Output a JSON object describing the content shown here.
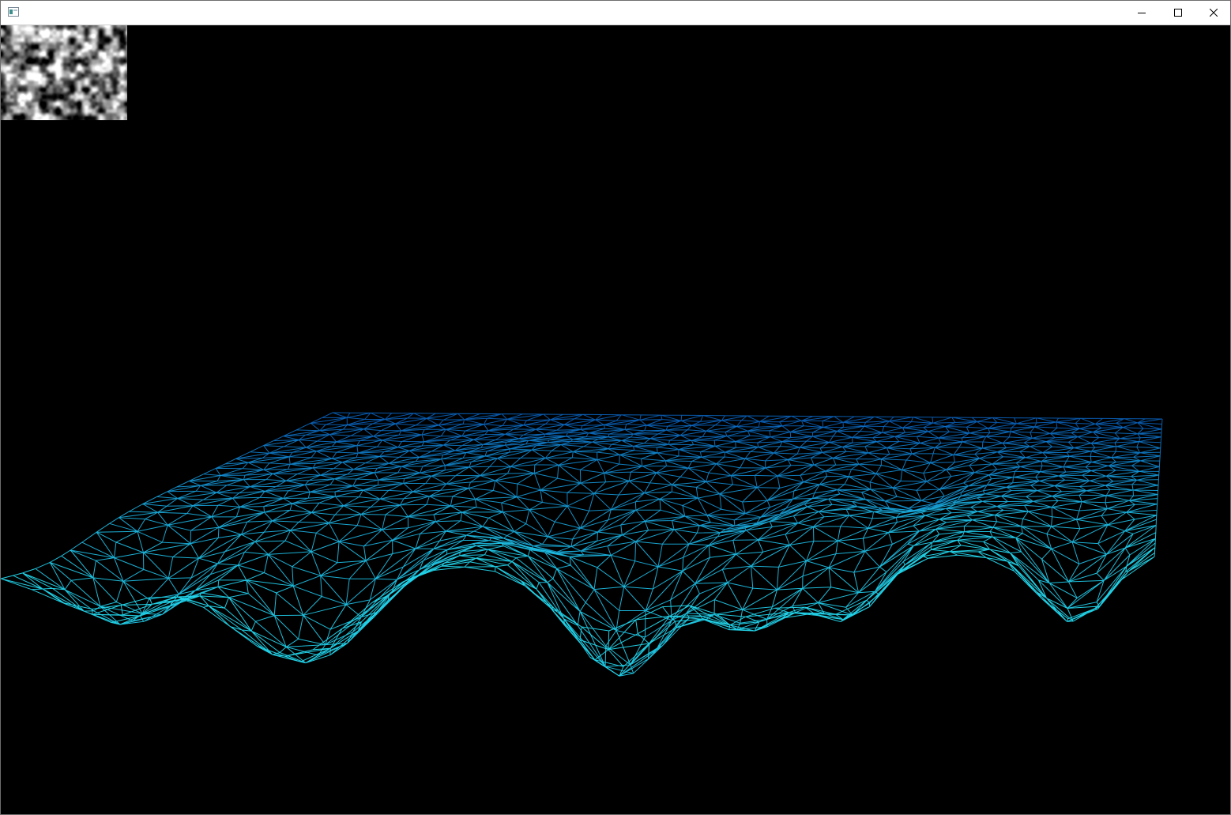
{
  "window": {
    "title": "",
    "icon": "app-window-icon",
    "controls": {
      "minimize_icon": "minimize-icon",
      "maximize_icon": "maximize-icon",
      "close_icon": "close-icon"
    }
  },
  "viewport": {
    "background_color": "#000000",
    "noise_preview": {
      "icon": "noise-heightmap-texture"
    },
    "terrain_mesh": {
      "render_mode": "wireframe",
      "color_near": "#23d8ee",
      "color_far": "#0a6fd6",
      "color_highlight": "#3fb8ff"
    }
  }
}
